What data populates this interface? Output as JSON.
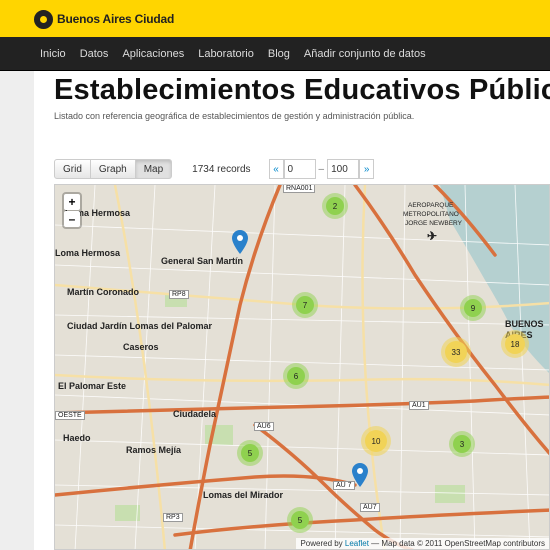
{
  "header": {
    "logo_text": "Buenos Aires Ciudad"
  },
  "nav": {
    "items": [
      "Inicio",
      "Datos",
      "Aplicaciones",
      "Laboratorio",
      "Blog",
      "Añadir conjunto de datos"
    ]
  },
  "page": {
    "title": "Establecimientos Educativos Públicos",
    "subtitle": "Listado con referencia geográfica de establecimientos de gestión y administración pública."
  },
  "toolbar": {
    "views": [
      "Grid",
      "Graph",
      "Map"
    ],
    "active_view": "Map",
    "records": "1734 records",
    "prev": "«",
    "from": "0",
    "separator": "–",
    "to": "100",
    "next": "»"
  },
  "map": {
    "zoom_in": "+",
    "zoom_out": "–",
    "attribution": {
      "prefix": "Powered by ",
      "link": "Leaflet",
      "suffix": " — Map data © 2011 OpenStreetMap contributors"
    },
    "place_labels": [
      "Loma Hermosa",
      "General San Martín",
      "Loma Hermosa",
      "Martín Coronado",
      "Ciudad Jardín Lomas del Palomar",
      "Caseros",
      "El Palomar Este",
      "Ciudadela",
      "Haedo",
      "Ramos Mejía",
      "Lomas del Mirador",
      "BUENOS AIRES",
      "AEROPARQUE",
      "METROPOLITANO",
      "JORGE NEWBERY"
    ],
    "road_labels": [
      "RNA001",
      "RP8",
      "AU6",
      "AU1",
      "AU 7",
      "AU7",
      "RP3",
      "OESTE"
    ],
    "clusters": [
      {
        "count": "2",
        "color": "green"
      },
      {
        "count": "7",
        "color": "green"
      },
      {
        "count": "9",
        "color": "green"
      },
      {
        "count": "33",
        "color": "yellow"
      },
      {
        "count": "18",
        "color": "yellow"
      },
      {
        "count": "6",
        "color": "green"
      },
      {
        "count": "10",
        "color": "yellow"
      },
      {
        "count": "3",
        "color": "green"
      },
      {
        "count": "5",
        "color": "green"
      },
      {
        "count": "5",
        "color": "green"
      }
    ],
    "colors": {
      "green_cluster": "#8fd14f",
      "yellow_cluster": "#f1d357",
      "marker": "#2a81cb",
      "highway": "#d8713e",
      "water": "#b5d0d0"
    }
  }
}
